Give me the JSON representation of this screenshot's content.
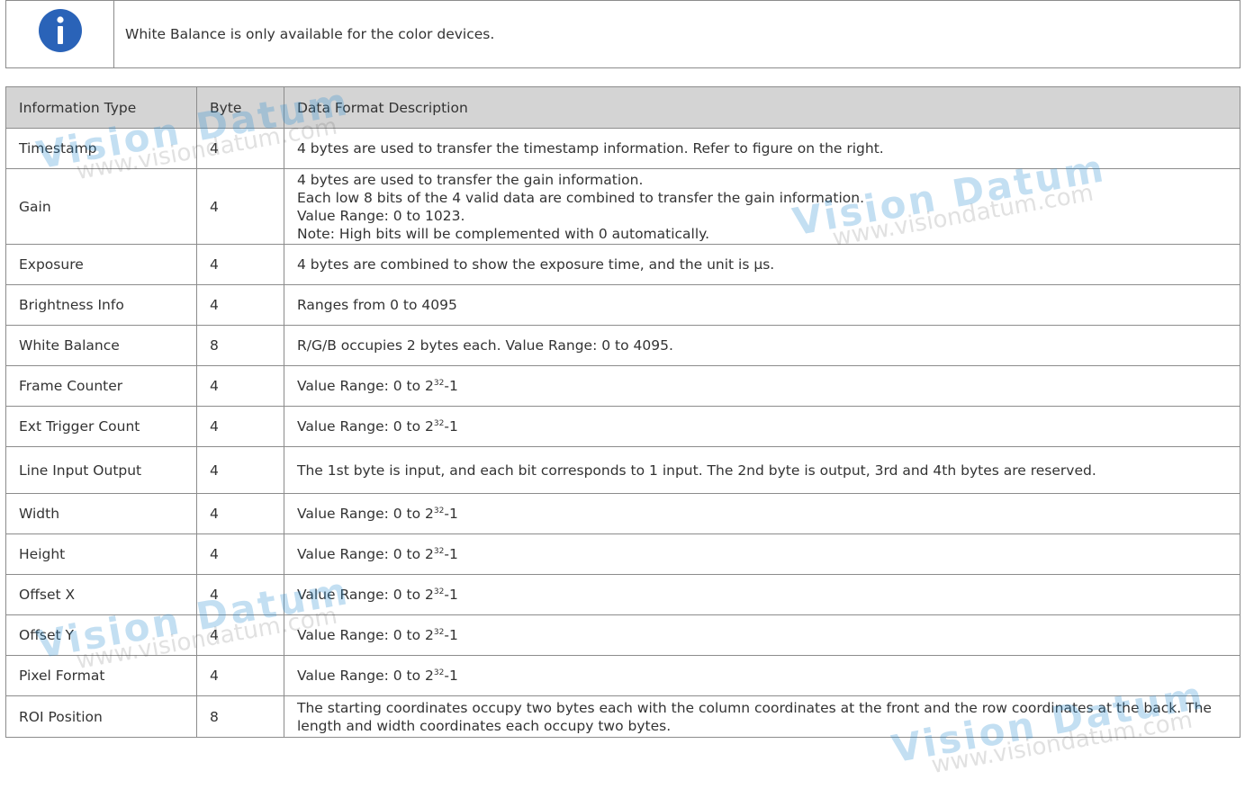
{
  "note": {
    "icon": "info-icon",
    "text": "White Balance is only available for the color devices."
  },
  "table": {
    "headers": [
      "Information Type",
      "Byte",
      "Data Format Description"
    ],
    "rows": [
      {
        "type": "Timestamp",
        "byte": "4",
        "desc": [
          "4 bytes are used to transfer the timestamp information. Refer to figure on the right."
        ]
      },
      {
        "type": "Gain",
        "byte": "4",
        "desc": [
          "4 bytes are used to transfer the gain information.",
          "Each low 8 bits of the 4 valid data are combined to transfer the gain information.",
          "Value Range: 0 to 1023.",
          "Note: High bits will be complemented with 0 automatically."
        ]
      },
      {
        "type": "Exposure",
        "byte": "4",
        "desc": [
          "4 bytes are combined to show the exposure time, and the unit is μs."
        ]
      },
      {
        "type": "Brightness Info",
        "byte": "4",
        "desc": [
          "Ranges from 0 to 4095"
        ]
      },
      {
        "type": "White Balance",
        "byte": "8",
        "desc": [
          "R/G/B occupies 2 bytes each. Value Range: 0 to 4095."
        ]
      },
      {
        "type": "Frame Counter",
        "byte": "4",
        "range": {
          "prefix": "Value Range: 0 to 2",
          "exp": "32",
          "suffix": "-1"
        }
      },
      {
        "type": "Ext Trigger Count",
        "byte": "4",
        "range": {
          "prefix": "Value Range: 0 to 2",
          "exp": "32",
          "suffix": "-1"
        }
      },
      {
        "type": "Line Input Output",
        "byte": "4",
        "desc": [
          "The 1st byte is input, and each bit corresponds to 1 input. The 2nd byte is output, 3rd and 4th bytes are reserved."
        ]
      },
      {
        "type": "Width",
        "byte": "4",
        "range": {
          "prefix": "Value Range: 0 to 2",
          "exp": "32",
          "suffix": "-1"
        }
      },
      {
        "type": "Height",
        "byte": "4",
        "range": {
          "prefix": "Value Range: 0 to 2",
          "exp": "32",
          "suffix": "-1"
        }
      },
      {
        "type": "Offset X",
        "byte": "4",
        "range": {
          "prefix": "Value Range: 0 to 2",
          "exp": "32",
          "suffix": "-1"
        }
      },
      {
        "type": "Offset Y",
        "byte": "4",
        "range": {
          "prefix": "Value Range: 0 to 2",
          "exp": "32",
          "suffix": "-1"
        }
      },
      {
        "type": "Pixel Format",
        "byte": "4",
        "range": {
          "prefix": "Value Range: 0 to 2",
          "exp": "32",
          "suffix": "-1"
        }
      },
      {
        "type": "ROI Position",
        "byte": "8",
        "desc": [
          "The starting coordinates occupy two bytes each with the column coordinates at the front and the row coordinates at the back. The length and width coordinates each occupy two bytes."
        ]
      }
    ]
  },
  "watermark": {
    "brand": "Vision Datum",
    "url": "www.visiondatum.com"
  },
  "colors": {
    "header_bg": "#d4d4d4",
    "border": "#8c8c8c",
    "icon_bg": "#2a63b8",
    "text": "#333333"
  }
}
